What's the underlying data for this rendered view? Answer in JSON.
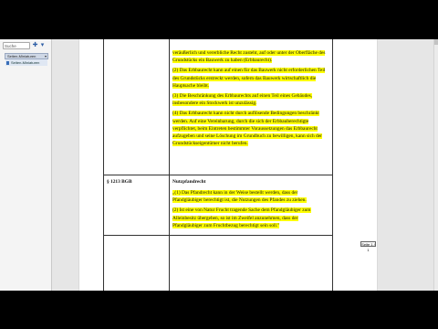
{
  "nav": {
    "search_placeholder": "Suche",
    "header_label": "Seiten-Miniaturen",
    "item_label": "Seiten-Miniaturen"
  },
  "tooltip": "Seite 1 / 1",
  "doc": {
    "upper_paragraphs": [
      "veräußerlich und vererbliche Recht zusteht, auf oder unter der Oberfläche des Grundstücks ein Bauwerk zu haben (Erbbaurecht).",
      "(2) Das Erbbaurecht kann auf einen für das Bauwerk nicht erforderlichen Teil des Grundstücks erstreckt werden, sofern das Bauwerk wirtschaftlich die Hauptsache bleibt.",
      "(3) Die Beschränkung des Erbbaurechts auf einen Teil eines Gebäudes, insbesondere ein Stockwerk ist unzulässig.",
      "(4) Das Erbbaurecht kann nicht durch auflösende Bedingungen beschränkt werden. Auf eine Vereinbarung, durch die sich der Erbbauberechtigte verpflichtet, beim Eintreten bestimmter Voraussetzungen das Erbbaurecht aufzugeben und seine Löschung im Grundbuch zu bewilligen, kann sich der Grundstückseigentümer nicht berufen."
    ],
    "section_code": "§ 1213 BGB",
    "section_title": "Nutzpfandrecht",
    "lower_paragraphs": [
      "„(1) Das Pfandrecht kann in der Weise bestellt werden, dass der Pfandgläubiger berechtigt ist, die Nutzungen des Pfandes zu ziehen.",
      "(2) Ist eine von Natur Frucht tragende Sache dem Pfandgläubiger zum Alleinbesitz übergeben, so ist im Zweifel anzunehmen, dass der Pfandgläubiger zum Fruchtbezug berechtigt sein soll.\""
    ]
  }
}
